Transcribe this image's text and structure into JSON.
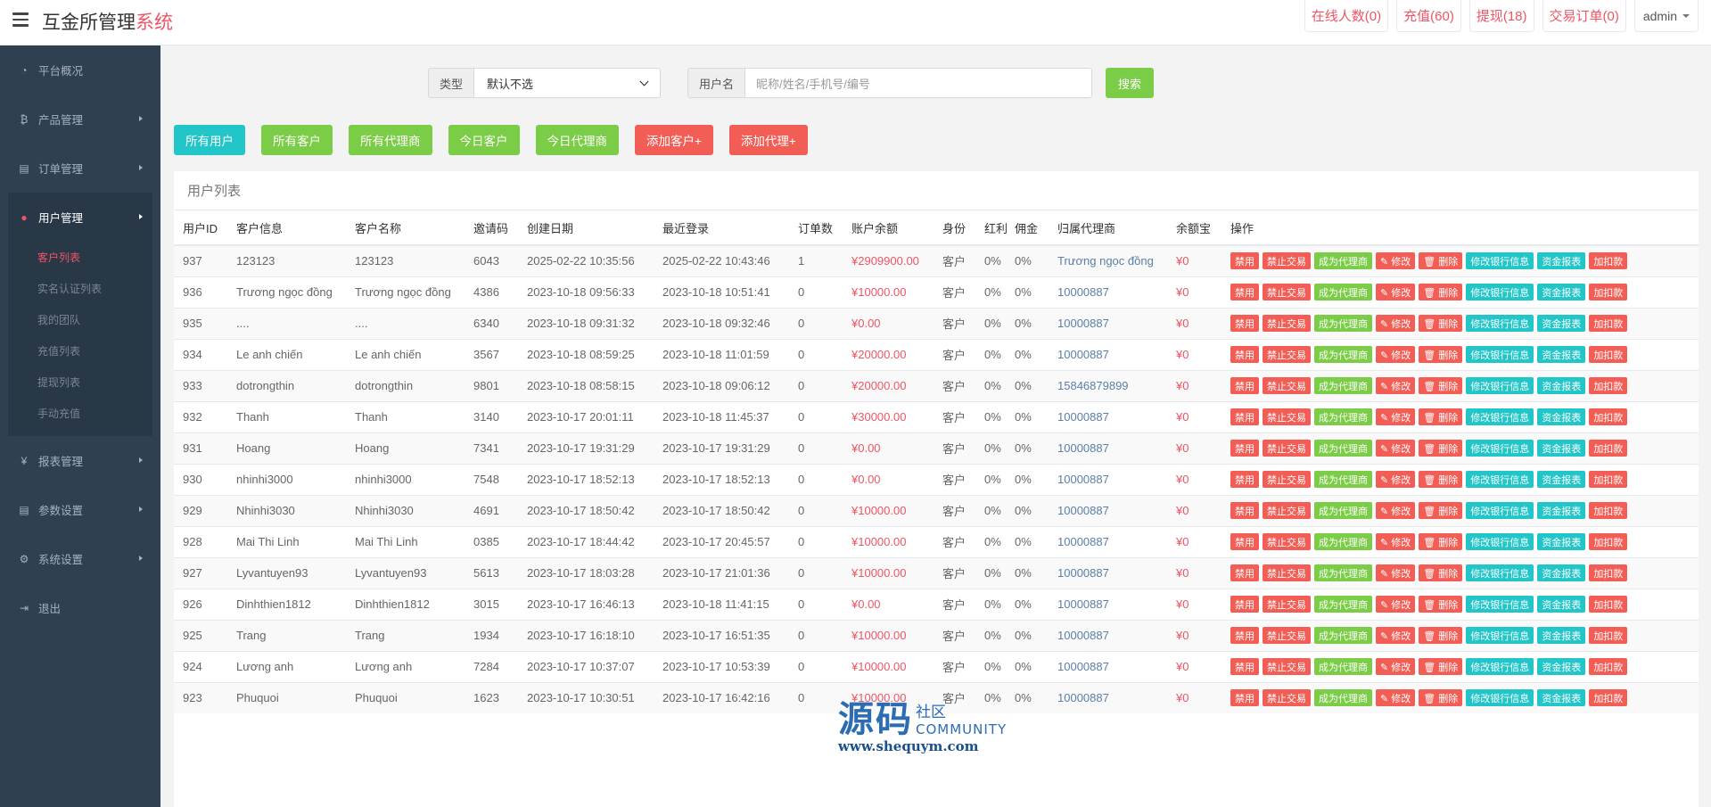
{
  "header": {
    "title_main": "互金所管理",
    "title_accent": "系统",
    "actions": [
      "在线人数(0)",
      "充值(60)",
      "提现(18)",
      "交易订单(0)"
    ],
    "user": "admin"
  },
  "sidebar": {
    "items": [
      {
        "icon": "dashboard-icon",
        "glyph": "◔",
        "label": "平台概况"
      },
      {
        "icon": "bitcoin-icon",
        "glyph": "₿",
        "label": "产品管理"
      },
      {
        "icon": "orders-icon",
        "glyph": "▤",
        "label": "订单管理"
      }
    ],
    "active_group": {
      "icon": "user-icon",
      "glyph": "●",
      "label": "用户管理",
      "sub": [
        "客户列表",
        "实名认证列表",
        "我的团队",
        "充值列表",
        "提现列表",
        "手动充值"
      ],
      "active_sub": 0
    },
    "items_after": [
      {
        "icon": "yen-icon",
        "glyph": "¥",
        "label": "报表管理"
      },
      {
        "icon": "params-icon",
        "glyph": "▤",
        "label": "参数设置"
      },
      {
        "icon": "gears-icon",
        "glyph": "⚙",
        "label": "系统设置"
      },
      {
        "icon": "logout-icon",
        "glyph": "⇥",
        "label": "退出"
      }
    ]
  },
  "filter": {
    "type_label": "类型",
    "type_value": "默认不选",
    "username_label": "用户名",
    "username_placeholder": "昵称/姓名/手机号/编号",
    "search_label": "搜索"
  },
  "quick_buttons": [
    {
      "label": "所有用户",
      "color": "cyan"
    },
    {
      "label": "所有客户",
      "color": "green"
    },
    {
      "label": "所有代理商",
      "color": "green"
    },
    {
      "label": "今日客户",
      "color": "green"
    },
    {
      "label": "今日代理商",
      "color": "green"
    },
    {
      "label": "添加客户+",
      "color": "red"
    },
    {
      "label": "添加代理+",
      "color": "red"
    }
  ],
  "panel_title": "用户列表",
  "columns": [
    "用户ID",
    "客户信息",
    "客户名称",
    "邀请码",
    "创建日期",
    "最近登录",
    "订单数",
    "账户余额",
    "身份",
    "红利",
    "佣金",
    "归属代理商",
    "余额宝",
    "操作"
  ],
  "row_actions": [
    {
      "label": "禁用",
      "color": "red"
    },
    {
      "label": "禁止交易",
      "color": "red"
    },
    {
      "label": "成为代理商",
      "color": "green"
    },
    {
      "label": "✎ 修改",
      "color": "red"
    },
    {
      "label": "🗑 删除",
      "color": "red"
    },
    {
      "label": "修改银行信息",
      "color": "cyan"
    },
    {
      "label": "资金报表",
      "color": "cyan"
    },
    {
      "label": "加扣款",
      "color": "red"
    }
  ],
  "rows": [
    [
      "937",
      "123123",
      "123123",
      "6043",
      "2025-02-22 10:35:56",
      "2025-02-22 10:43:46",
      "1",
      "¥2909900.00",
      "客户",
      "0%",
      "0%",
      "Trương ngọc đồng",
      "¥0"
    ],
    [
      "936",
      "Trương ngọc đồng",
      "Trương ngọc đồng",
      "4386",
      "2023-10-18 09:56:33",
      "2023-10-18 10:51:41",
      "0",
      "¥10000.00",
      "客户",
      "0%",
      "0%",
      "10000887",
      "¥0"
    ],
    [
      "935",
      "....",
      "....",
      "6340",
      "2023-10-18 09:31:32",
      "2023-10-18 09:32:46",
      "0",
      "¥0.00",
      "客户",
      "0%",
      "0%",
      "10000887",
      "¥0"
    ],
    [
      "934",
      "Le anh chiến",
      "Le anh chiến",
      "3567",
      "2023-10-18 08:59:25",
      "2023-10-18 11:01:59",
      "0",
      "¥20000.00",
      "客户",
      "0%",
      "0%",
      "10000887",
      "¥0"
    ],
    [
      "933",
      "dotrongthin",
      "dotrongthin",
      "9801",
      "2023-10-18 08:58:15",
      "2023-10-18 09:06:12",
      "0",
      "¥20000.00",
      "客户",
      "0%",
      "0%",
      "15846879899",
      "¥0"
    ],
    [
      "932",
      "Thanh",
      "Thanh",
      "3140",
      "2023-10-17 20:01:11",
      "2023-10-18 11:45:37",
      "0",
      "¥30000.00",
      "客户",
      "0%",
      "0%",
      "10000887",
      "¥0"
    ],
    [
      "931",
      "Hoang",
      "Hoang",
      "7341",
      "2023-10-17 19:31:29",
      "2023-10-17 19:31:29",
      "0",
      "¥0.00",
      "客户",
      "0%",
      "0%",
      "10000887",
      "¥0"
    ],
    [
      "930",
      "nhinhi3000",
      "nhinhi3000",
      "7548",
      "2023-10-17 18:52:13",
      "2023-10-17 18:52:13",
      "0",
      "¥0.00",
      "客户",
      "0%",
      "0%",
      "10000887",
      "¥0"
    ],
    [
      "929",
      "Nhinhi3030",
      "Nhinhi3030",
      "4691",
      "2023-10-17 18:50:42",
      "2023-10-17 18:50:42",
      "0",
      "¥10000.00",
      "客户",
      "0%",
      "0%",
      "10000887",
      "¥0"
    ],
    [
      "928",
      "Mai Thi Linh",
      "Mai Thi Linh",
      "0385",
      "2023-10-17 18:44:42",
      "2023-10-17 20:45:57",
      "0",
      "¥10000.00",
      "客户",
      "0%",
      "0%",
      "10000887",
      "¥0"
    ],
    [
      "927",
      "Lyvantuyen93",
      "Lyvantuyen93",
      "5613",
      "2023-10-17 18:03:28",
      "2023-10-17 21:01:36",
      "0",
      "¥10000.00",
      "客户",
      "0%",
      "0%",
      "10000887",
      "¥0"
    ],
    [
      "926",
      "Dinhthien1812",
      "Dinhthien1812",
      "3015",
      "2023-10-17 16:46:13",
      "2023-10-18 11:41:15",
      "0",
      "¥0.00",
      "客户",
      "0%",
      "0%",
      "10000887",
      "¥0"
    ],
    [
      "925",
      "Trang",
      "Trang",
      "1934",
      "2023-10-17 16:18:10",
      "2023-10-17 16:51:35",
      "0",
      "¥10000.00",
      "客户",
      "0%",
      "0%",
      "10000887",
      "¥0"
    ],
    [
      "924",
      "Lương anh",
      "Lương anh",
      "7284",
      "2023-10-17 10:37:07",
      "2023-10-17 10:53:39",
      "0",
      "¥10000.00",
      "客户",
      "0%",
      "0%",
      "10000887",
      "¥0"
    ],
    [
      "923",
      "Phuquoi",
      "Phuquoi",
      "1623",
      "2023-10-17 10:30:51",
      "2023-10-17 16:42:16",
      "0",
      "¥10000.00",
      "客户",
      "0%",
      "0%",
      "10000887",
      "¥0"
    ]
  ],
  "watermark": {
    "big": "源码",
    "small": "社区",
    "community": "COMMUNITY",
    "url": "www.shequym.com"
  },
  "colors": {
    "sidebar": "#2f4050",
    "accent_red": "#ed5565",
    "btn_red": "#f25e55",
    "btn_green": "#7bcc46",
    "btn_cyan": "#23c6c8"
  }
}
